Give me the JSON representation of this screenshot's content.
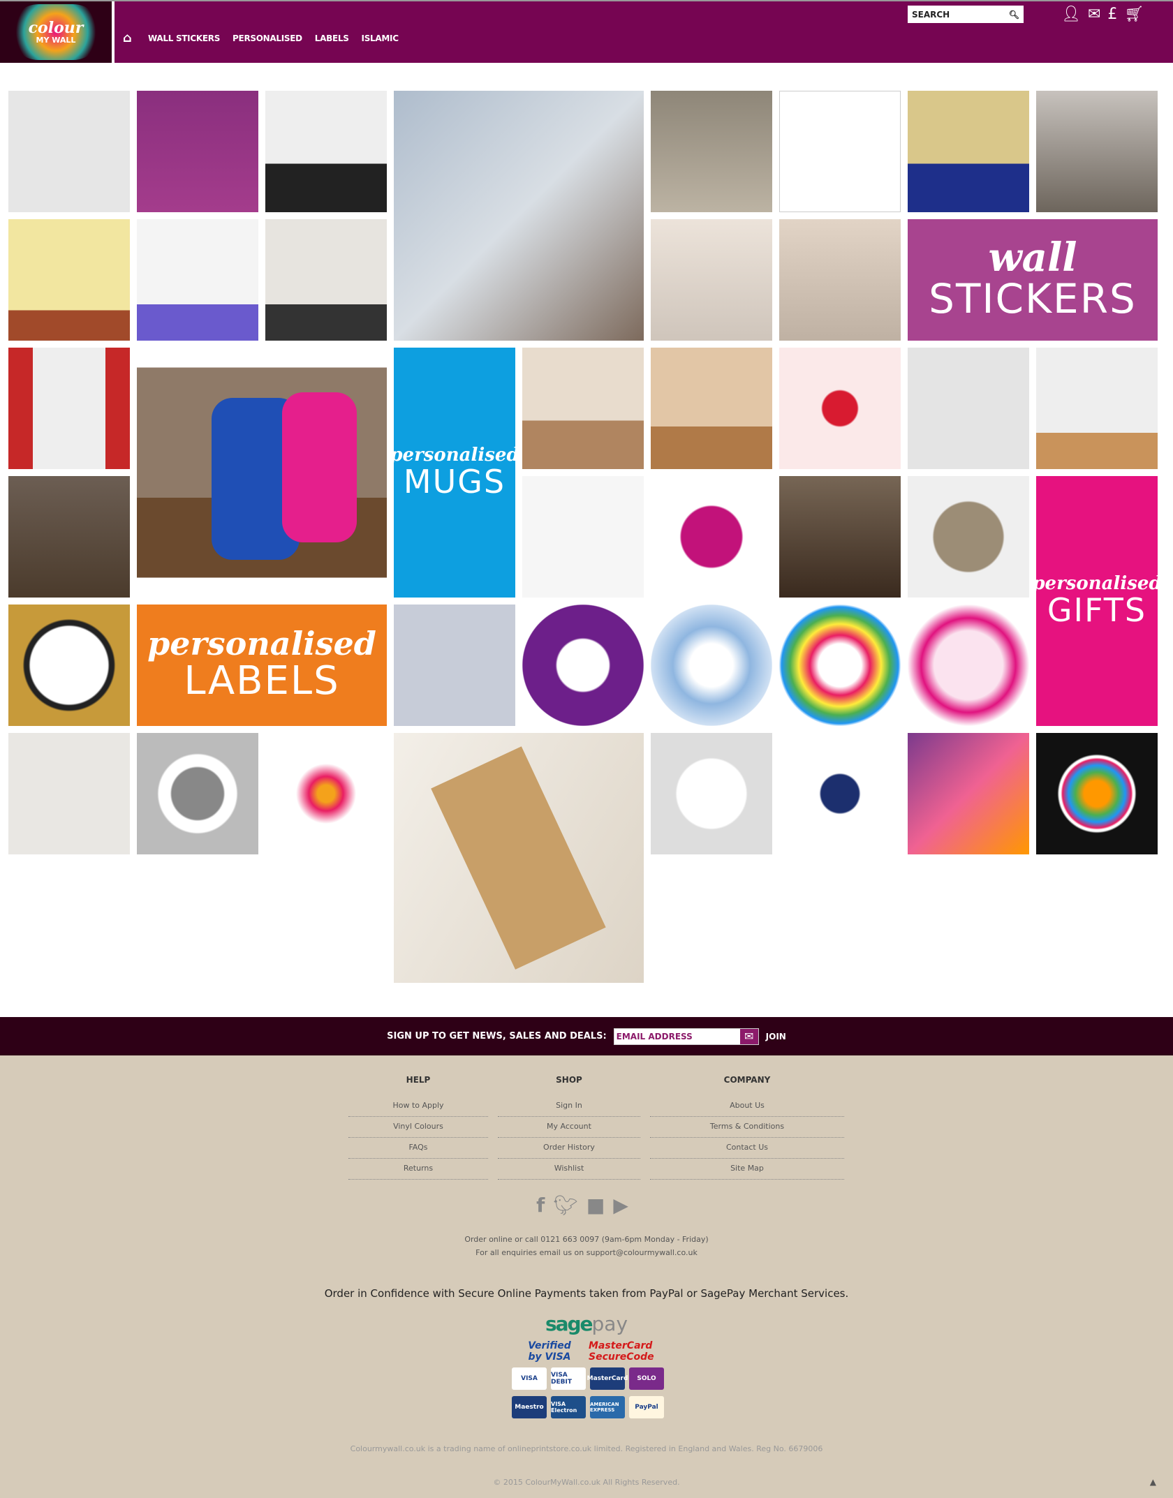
{
  "header": {
    "logo_text": "colour MY WALL",
    "nav": [
      "WALL STICKERS",
      "PERSONALISED",
      "LABELS",
      "ISLAMIC"
    ],
    "search_placeholder": "SEARCH",
    "icons": [
      "user-icon",
      "mail-icon",
      "pound-icon",
      "basket-icon"
    ]
  },
  "banners": {
    "wall": {
      "script": "wall",
      "big": "STICKERS"
    },
    "mugs": {
      "script": "personalised",
      "big": "MUGS"
    },
    "labels": {
      "script": "personalised",
      "big": "LABELS"
    },
    "gifts": {
      "script": "personalised",
      "big": "GIFTS"
    }
  },
  "newsletter": {
    "label": "SIGN UP TO GET NEWS, SALES AND DEALS:",
    "placeholder": "EMAIL ADDRESS",
    "join": "JOIN"
  },
  "footer": {
    "columns": [
      {
        "title": "HELP",
        "links": [
          "How to Apply",
          "Vinyl Colours",
          "FAQs",
          "Returns"
        ]
      },
      {
        "title": "SHOP",
        "links": [
          "Sign In",
          "My Account",
          "Order History",
          "Wishlist"
        ]
      },
      {
        "title": "COMPANY",
        "links": [
          "About Us",
          "Terms & Conditions",
          "Contact Us",
          "Site Map"
        ]
      }
    ],
    "contact_line1": "Order online or call 0121 663 0097 (9am-6pm Monday - Friday)",
    "contact_line2": "For all enquiries email us on support@colourmywall.co.uk",
    "confidence": "Order in Confidence with Secure Online Payments taken from PayPal or SagePay Merchant Services.",
    "sagepay": {
      "a": "sage",
      "b": "pay"
    },
    "verified": "Verified by VISA",
    "mastercard": "MasterCard SecureCode",
    "cards_row1": [
      "VISA",
      "VISA DEBIT",
      "MasterCard",
      "SOLO"
    ],
    "cards_row2": [
      "Maestro",
      "VISA Electron",
      "AMERICAN EXPRESS",
      "PayPal"
    ],
    "legal": "Colourmywall.co.uk is a trading name of onlineprintstore.co.uk limited. Registered in England and Wales. Reg No. 6679006",
    "copyright": "© 2015 ColourMyWall.co.uk All Rights Reserved."
  },
  "colors": {
    "header": "#760552",
    "newsletter": "#2e0016",
    "footer": "#d6cbb9",
    "wall_banner": "#a8448f",
    "mugs_banner": "#0d9fe0",
    "labels_banner": "#ef7d1e",
    "gifts_banner": "#e6127f"
  }
}
